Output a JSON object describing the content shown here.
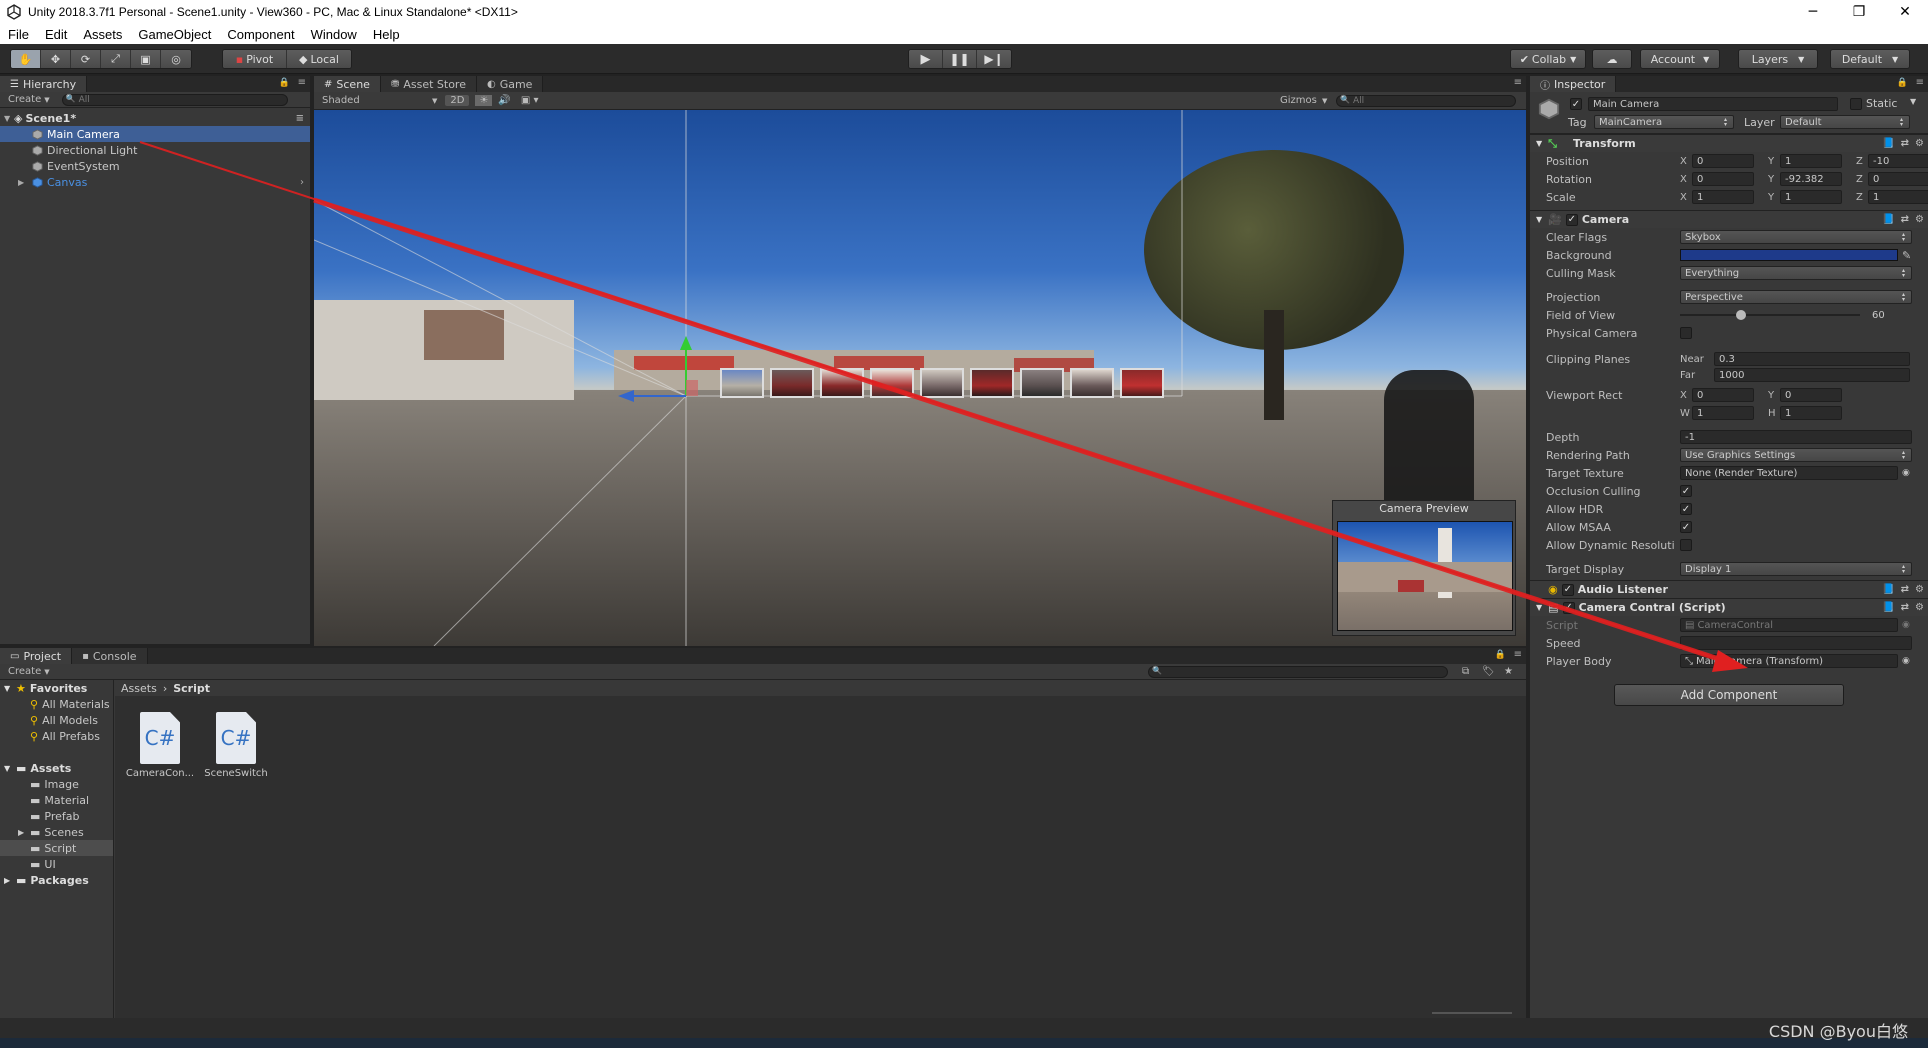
{
  "window": {
    "title": "Unity 2018.3.7f1 Personal - Scene1.unity - View360 - PC, Mac & Linux Standalone* <DX11>",
    "minimize": "─",
    "maximize": "❐",
    "close": "✕"
  },
  "menu": [
    "File",
    "Edit",
    "Assets",
    "GameObject",
    "Component",
    "Window",
    "Help"
  ],
  "toolbar": {
    "pivot": "Pivot",
    "local": "Local",
    "collab": "Collab",
    "account": "Account",
    "layers": "Layers",
    "layout": "Default"
  },
  "hierarchy": {
    "tab": "Hierarchy",
    "create": "Create",
    "search_placeholder": "All",
    "scene": "Scene1*",
    "items": [
      "Main Camera",
      "Directional Light",
      "EventSystem",
      "Canvas"
    ]
  },
  "scene": {
    "tabs": [
      "Scene",
      "Asset Store",
      "Game"
    ],
    "shading": "Shaded",
    "mode_2d": "2D",
    "gizmos": "Gizmos",
    "search_placeholder": "All",
    "camera_preview": "Camera Preview"
  },
  "inspector": {
    "tab": "Inspector",
    "object_name": "Main Camera",
    "static": "Static",
    "tag_label": "Tag",
    "tag": "MainCamera",
    "layer_label": "Layer",
    "layer": "Default",
    "transform": {
      "title": "Transform",
      "position_label": "Position",
      "rotation_label": "Rotation",
      "scale_label": "Scale",
      "position": {
        "x": "0",
        "y": "1",
        "z": "-10"
      },
      "rotation": {
        "x": "0",
        "y": "-92.382",
        "z": "0"
      },
      "scale": {
        "x": "1",
        "y": "1",
        "z": "1"
      }
    },
    "camera": {
      "title": "Camera",
      "clear_flags_label": "Clear Flags",
      "clear_flags": "Skybox",
      "background_label": "Background",
      "background_color": "#1e3a8a",
      "culling_mask_label": "Culling Mask",
      "culling_mask": "Everything",
      "projection_label": "Projection",
      "projection": "Perspective",
      "fov_label": "Field of View",
      "fov": "60",
      "fov_fraction": 0.33,
      "physical_label": "Physical Camera",
      "clipping_label": "Clipping Planes",
      "near_label": "Near",
      "near": "0.3",
      "far_label": "Far",
      "far": "1000",
      "viewport_label": "Viewport Rect",
      "vx": "0",
      "vy": "0",
      "vw": "1",
      "vh": "1",
      "depth_label": "Depth",
      "depth": "-1",
      "rendering_path_label": "Rendering Path",
      "rendering_path": "Use Graphics Settings",
      "target_texture_label": "Target Texture",
      "target_texture": "None (Render Texture)",
      "occlusion_label": "Occlusion Culling",
      "hdr_label": "Allow HDR",
      "msaa_label": "Allow MSAA",
      "dynres_label": "Allow Dynamic Resoluti",
      "target_display_label": "Target Display",
      "target_display": "Display 1"
    },
    "audio_listener": "Audio Listener",
    "script_component": {
      "title": "Camera Contral (Script)",
      "script_label": "Script",
      "script": "CameraContral",
      "speed_label": "Speed",
      "player_body_label": "Player Body",
      "player_body": "Main Camera (Transform)"
    },
    "add_component": "Add Component"
  },
  "project": {
    "tabs": [
      "Project",
      "Console"
    ],
    "create": "Create",
    "favorites": "Favorites",
    "fav_items": [
      "All Materials",
      "All Models",
      "All Prefabs"
    ],
    "assets": "Assets",
    "asset_folders": [
      "Image",
      "Material",
      "Prefab",
      "Scenes",
      "Script",
      "UI"
    ],
    "packages": "Packages",
    "breadcrumb_root": "Assets",
    "breadcrumb_current": "Script",
    "files": [
      "CameraCon...",
      "SceneSwitch"
    ],
    "file_glyph": "C#"
  },
  "watermark": "CSDN @Byou白悠"
}
